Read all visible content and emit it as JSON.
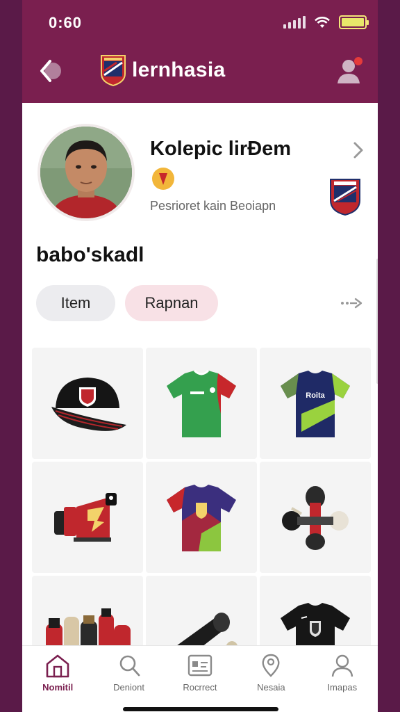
{
  "status_bar": {
    "time": "0:60"
  },
  "header": {
    "title": "lernhasia"
  },
  "profile": {
    "name": "Kolepic lirÐem",
    "subtitle": "Pesrioret kain Beoiapn"
  },
  "section": {
    "title": "babo'skadl"
  },
  "chips": [
    {
      "label": "Item"
    },
    {
      "label": "Rapnan"
    }
  ],
  "products": [
    {
      "name": "cap",
      "icon": "cap-icon"
    },
    {
      "name": "green-jersey",
      "icon": "jersey-icon"
    },
    {
      "name": "navy-jersey",
      "icon": "jersey-icon",
      "print": "Roita"
    },
    {
      "name": "arm-bands",
      "icon": "armband-icon"
    },
    {
      "name": "purple-jersey",
      "icon": "jersey-icon"
    },
    {
      "name": "gear-stick",
      "icon": "gear-icon"
    },
    {
      "name": "bottles",
      "icon": "bottle-icon"
    },
    {
      "name": "tube-pack",
      "icon": "tube-icon"
    },
    {
      "name": "black-jersey",
      "icon": "jersey-icon"
    }
  ],
  "tabs": [
    {
      "label": "Nomitil",
      "icon": "home-icon",
      "active": true
    },
    {
      "label": "Deniont",
      "icon": "search-icon",
      "active": false
    },
    {
      "label": "Rocrrect",
      "icon": "card-icon",
      "active": false
    },
    {
      "label": "Nesaia",
      "icon": "map-pin-icon",
      "active": false
    },
    {
      "label": "Imapas",
      "icon": "profile-icon",
      "active": false
    }
  ],
  "colors": {
    "brand": "#7a1f4f",
    "background": "#5a1a48",
    "chip_item": "#ececef",
    "chip_rapnan": "#f8e1e6"
  }
}
